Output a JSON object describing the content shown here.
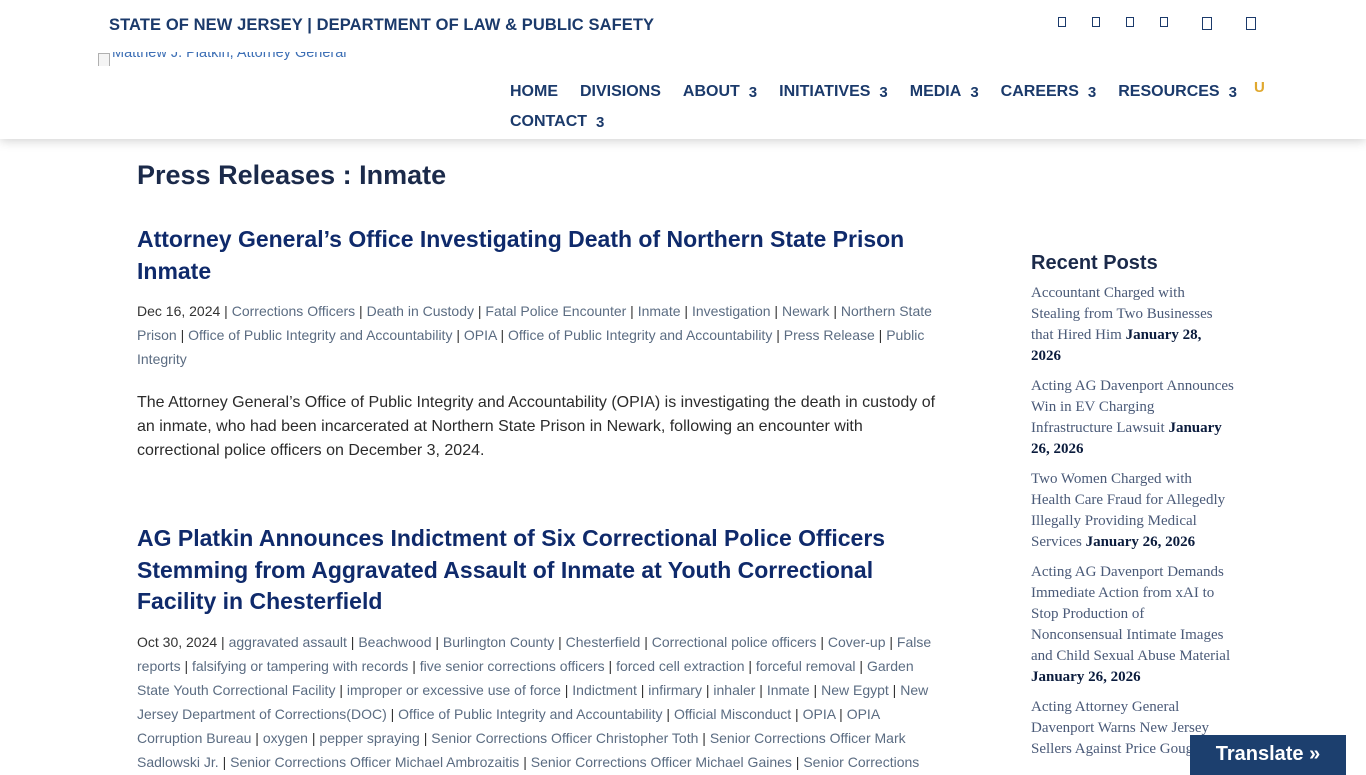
{
  "header": {
    "agency": "STATE OF NEW JERSEY | DEPARTMENT OF LAW & PUBLIC SAFETY",
    "logo_alt": "Matthew J. Platkin, Attorney General",
    "social_icons": [
      "social-icon-1",
      "social-icon-2",
      "social-icon-3",
      "social-icon-4",
      "social-icon-5",
      "social-icon-6"
    ],
    "nav_row1": [
      {
        "label": "HOME",
        "arrow": ""
      },
      {
        "label": "DIVISIONS",
        "arrow": ""
      },
      {
        "label": "ABOUT",
        "arrow": "3"
      },
      {
        "label": "INITIATIVES",
        "arrow": "3"
      },
      {
        "label": "MEDIA",
        "arrow": "3"
      },
      {
        "label": "CAREERS",
        "arrow": "3"
      },
      {
        "label": "RESOURCES",
        "arrow": "3"
      }
    ],
    "nav_row2": [
      {
        "label": "CONTACT",
        "arrow": "3"
      }
    ],
    "search_glyph": "U"
  },
  "page_title": "Press Releases : Inmate",
  "posts": [
    {
      "title": "Attorney General’s Office Investigating Death of Northern State Prison Inmate",
      "date": "Dec 16, 2024",
      "tags": [
        "Corrections Officers",
        "Death in Custody",
        "Fatal Police Encounter",
        "Inmate",
        "Investigation",
        "Newark",
        "Northern State Prison",
        "Office of Public Integrity and Accountability",
        "OPIA",
        "Office of Public Integrity and Accountability",
        "Press Release",
        "Public Integrity"
      ],
      "excerpt": "The Attorney General’s Office of Public Integrity and Accountability (OPIA) is investigating the death in custody of an inmate, who had been incarcerated at Northern State Prison in Newark, following an encounter with correctional police officers on December 3, 2024."
    },
    {
      "title": "AG Platkin Announces Indictment of Six Correctional Police Officers Stemming from Aggravated Assault of Inmate at Youth Correctional Facility in Chesterfield",
      "date": "Oct 30, 2024",
      "tags": [
        "aggravated assault",
        "Beachwood",
        "Burlington County",
        "Chesterfield",
        "Correctional police officers",
        "Cover-up",
        "False reports",
        "falsifying or tampering with records",
        "five senior corrections officers",
        "forced cell extraction",
        "forceful removal",
        "Garden State Youth Correctional Facility",
        "improper or excessive use of force",
        "Indictment",
        "infirmary",
        "inhaler",
        "Inmate",
        "New Egypt",
        "New Jersey Department of Corrections(DOC)",
        "Office of Public Integrity and Accountability",
        "Official Misconduct",
        "OPIA",
        "OPIA Corruption Bureau",
        "oxygen",
        "pepper spraying",
        "Senior Corrections Officer Christopher Toth",
        "Senior Corrections Officer Mark Sadlowski Jr.",
        "Senior Corrections Officer Michael Ambrozaitis",
        "Senior Corrections Officer Michael Gaines",
        "Senior Corrections"
      ]
    }
  ],
  "sidebar": {
    "heading": "Recent Posts",
    "items": [
      {
        "title": "Accountant Charged with Stealing from Two Businesses that Hired Him",
        "date": "January 28, 2026"
      },
      {
        "title": "Acting AG Davenport Announces Win in EV Charging Infrastructure Lawsuit",
        "date": "January 26, 2026"
      },
      {
        "title": "Two Women Charged with Health Care Fraud for Allegedly Illegally Providing Medical Services",
        "date": "January 26, 2026"
      },
      {
        "title": "Acting AG Davenport Demands Immediate Action from xAI to Stop Production of Nonconsensual Intimate Images and Child Sexual Abuse Material",
        "date": "January 26, 2026"
      },
      {
        "title": "Acting Attorney General Davenport Warns New Jersey Sellers Against Price Gouging",
        "date": ""
      }
    ]
  },
  "translate_label": "Translate »"
}
